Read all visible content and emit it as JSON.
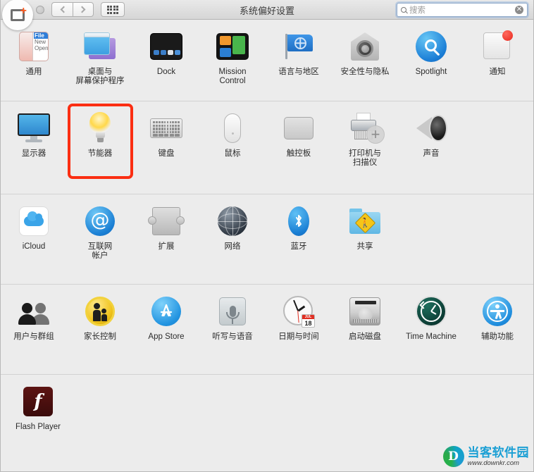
{
  "window": {
    "title": "系统偏好设置",
    "traffic_lights": [
      "close",
      "minimize",
      "zoom"
    ],
    "nav_back_label": "‹",
    "nav_forward_label": "›",
    "grid_button_name": "显示全部"
  },
  "search": {
    "placeholder": "搜索",
    "value": "",
    "clear_label": "✕"
  },
  "highlight": {
    "target": "节能器",
    "color": "#fb2e12"
  },
  "rows": [
    {
      "id": "personal",
      "items": [
        {
          "label": "通用",
          "icon": "general-icon"
        },
        {
          "label": "桌面与\n屏幕保护程序",
          "label_line1": "桌面与",
          "label_line2": "屏幕保护程序",
          "icon": "desktop-screensaver-icon"
        },
        {
          "label": "Dock",
          "icon": "dock-icon"
        },
        {
          "label": "Mission\nControl",
          "label_line1": "Mission",
          "label_line2": "Control",
          "icon": "mission-control-icon"
        },
        {
          "label": "语言与地区",
          "icon": "language-region-icon"
        },
        {
          "label": "安全性与隐私",
          "icon": "security-privacy-icon"
        },
        {
          "label": "Spotlight",
          "icon": "spotlight-icon"
        },
        {
          "label": "通知",
          "icon": "notifications-icon"
        }
      ]
    },
    {
      "id": "hardware",
      "items": [
        {
          "label": "显示器",
          "icon": "displays-icon"
        },
        {
          "label": "节能器",
          "icon": "energy-saver-icon",
          "highlighted": true
        },
        {
          "label": "键盘",
          "icon": "keyboard-icon"
        },
        {
          "label": "鼠标",
          "icon": "mouse-icon"
        },
        {
          "label": "触控板",
          "icon": "trackpad-icon"
        },
        {
          "label": "打印机与\n扫描仪",
          "label_line1": "打印机与",
          "label_line2": "扫描仪",
          "icon": "printers-scanners-icon"
        },
        {
          "label": "声音",
          "icon": "sound-icon"
        }
      ]
    },
    {
      "id": "internet",
      "items": [
        {
          "label": "iCloud",
          "icon": "icloud-icon"
        },
        {
          "label": "互联网\n帐户",
          "label_line1": "互联网",
          "label_line2": "帐户",
          "icon": "internet-accounts-icon"
        },
        {
          "label": "扩展",
          "icon": "extensions-icon"
        },
        {
          "label": "网络",
          "icon": "network-icon"
        },
        {
          "label": "蓝牙",
          "icon": "bluetooth-icon"
        },
        {
          "label": "共享",
          "icon": "sharing-icon"
        }
      ]
    },
    {
      "id": "system",
      "items": [
        {
          "label": "用户与群组",
          "icon": "users-groups-icon"
        },
        {
          "label": "家长控制",
          "icon": "parental-controls-icon"
        },
        {
          "label": "App Store",
          "icon": "app-store-icon"
        },
        {
          "label": "听写与语音",
          "icon": "dictation-speech-icon"
        },
        {
          "label": "日期与时间",
          "icon": "date-time-icon"
        },
        {
          "label": "启动磁盘",
          "icon": "startup-disk-icon"
        },
        {
          "label": "Time Machine",
          "icon": "time-machine-icon"
        },
        {
          "label": "辅助功能",
          "icon": "accessibility-icon"
        }
      ]
    },
    {
      "id": "other",
      "items": [
        {
          "label": "Flash Player",
          "icon": "flash-player-icon"
        }
      ]
    }
  ],
  "icons": {
    "date_time_month": "JUL",
    "date_time_day": "18",
    "general_menu_file": "File",
    "general_menu_new": "New",
    "general_menu_open": "Open",
    "sharing_sign_glyph": "🚶",
    "internet_accounts_glyph": "@",
    "flash_glyph": "f",
    "printer_plus_glyph": "+"
  },
  "watermark": {
    "logo_letter": "D",
    "name": "当客软件园",
    "url": "www.downkr.com"
  }
}
